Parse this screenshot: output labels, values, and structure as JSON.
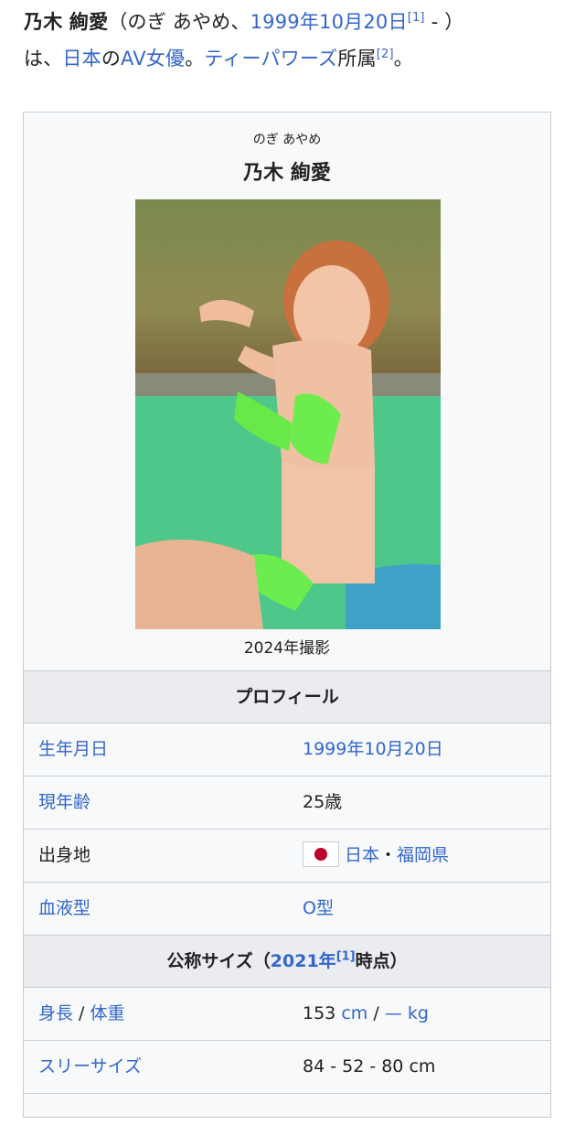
{
  "intro": {
    "name": "乃木 絢愛",
    "open_paren": "（のぎ あやめ、",
    "birth_link": "1999年10月20日",
    "ref1": "[1]",
    "dash": " - ）",
    "line2_prefix": "は、",
    "country_link": "日本",
    "no": "の",
    "genre_link": "AV女優",
    "period": "。",
    "agency_link": "ティーパワーズ",
    "agency_suffix": "所属",
    "ref2": "[2]",
    "end": "。"
  },
  "infobox": {
    "kana": "のぎ あやめ",
    "title": "乃木 絢愛",
    "photo_caption": "2024年撮影",
    "section_profile": "プロフィール",
    "rows": [
      {
        "label": "生年月日",
        "value": "1999年10月20日"
      },
      {
        "label": "現年齢",
        "value": "25歳"
      },
      {
        "label": "出身地",
        "value_country": "日本",
        "sep": "・",
        "value_pref": "福岡県"
      },
      {
        "label": "血液型",
        "value": "O型"
      }
    ],
    "section_size": {
      "prefix": "公称サイズ（",
      "year_link": "2021年",
      "ref": "[1]",
      "suffix": "時点）"
    },
    "size_rows": {
      "height_weight": {
        "label_a": "身長",
        "slash": " / ",
        "label_b": "体重",
        "height": "153",
        "unit_cm": "cm",
        "slash2": " / ",
        "weight": "—",
        "unit_kg": "kg"
      },
      "three_size": {
        "label": "スリーサイズ",
        "value": "84 - 52 - 80 cm"
      }
    }
  },
  "colors": {
    "link": "#3366cc",
    "header_bg": "#eaecf0",
    "border": "#c8ccd1",
    "flag_red": "#bc002d"
  }
}
